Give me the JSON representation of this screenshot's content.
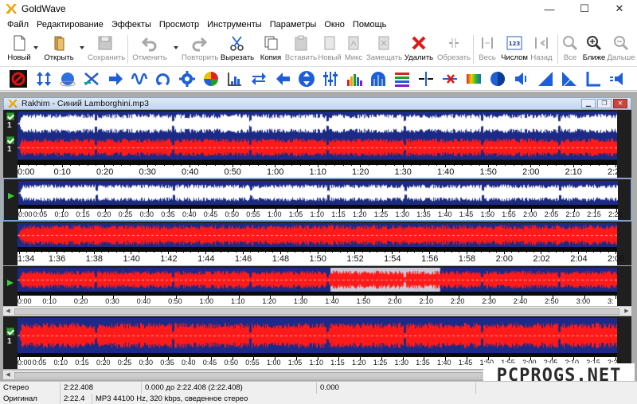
{
  "window": {
    "title": "GoldWave",
    "minimize": "—",
    "maximize": "☐",
    "close": "✕"
  },
  "menu": [
    "Файл",
    "Редактирование",
    "Эффекты",
    "Просмотр",
    "Инструменты",
    "Параметры",
    "Окно",
    "Помощь"
  ],
  "toolbar": [
    {
      "id": "new",
      "label": "Новый",
      "enabled": true
    },
    {
      "id": "open",
      "label": "Открыть",
      "enabled": true
    },
    {
      "id": "save",
      "label": "Сохранить",
      "enabled": false
    },
    {
      "id": "undo",
      "label": "Отменить",
      "enabled": false
    },
    {
      "id": "redo",
      "label": "Повторить",
      "enabled": false
    },
    {
      "id": "cut",
      "label": "Вырезать",
      "enabled": true
    },
    {
      "id": "copy",
      "label": "Копия",
      "enabled": true
    },
    {
      "id": "paste",
      "label": "Вставить",
      "enabled": false
    },
    {
      "id": "paste-new",
      "label": "Новый",
      "enabled": false
    },
    {
      "id": "mix",
      "label": "Микс",
      "enabled": false
    },
    {
      "id": "replace",
      "label": "Замещать",
      "enabled": false
    },
    {
      "id": "delete",
      "label": "Удалить",
      "enabled": true
    },
    {
      "id": "trim",
      "label": "Обрезать",
      "enabled": false
    },
    {
      "id": "all",
      "label": "Весь",
      "enabled": false
    },
    {
      "id": "numeric",
      "label": "Числом",
      "enabled": true
    },
    {
      "id": "back",
      "label": "Назад",
      "enabled": false
    },
    {
      "id": "zoom-all",
      "label": "Все",
      "enabled": false
    },
    {
      "id": "zoom-in",
      "label": "Ближе",
      "enabled": true
    },
    {
      "id": "zoom-out",
      "label": "Дальше",
      "enabled": false
    }
  ],
  "document": {
    "title": "Rakhim - Синий Lamborghini.mp3"
  },
  "channels": {
    "ch1": "1",
    "ch2": "1"
  },
  "rulers": {
    "main": [
      "0:00",
      "0:10",
      "0:20",
      "0:30",
      "0:40",
      "0:50",
      "1:00",
      "1:10",
      "1:20",
      "1:30",
      "1:40",
      "1:50",
      "2:00",
      "2:10",
      "2:2"
    ],
    "overview1": [
      "0:00",
      "0:05",
      "0:10",
      "0:15",
      "0:20",
      "0:25",
      "0:30",
      "0:35",
      "0:40",
      "0:45",
      "0:50",
      "0:55",
      "1:00",
      "1:05",
      "1:10",
      "1:15",
      "1:20",
      "1:25",
      "1:30",
      "1:35",
      "1:40",
      "1:45",
      "1:50",
      "1:55",
      "2:00",
      "2:05",
      "2:10",
      "2:15",
      "2:20"
    ],
    "zoomed": [
      "1:34",
      "1:36",
      "1:38",
      "1:40",
      "1:42",
      "1:44",
      "1:46",
      "1:48",
      "1:50",
      "1:52",
      "1:54",
      "1:56",
      "1:58",
      "2:00",
      "2:02",
      "2:04",
      "2:06"
    ],
    "overview2": [
      "0:00",
      "0:10",
      "0:20",
      "0:30",
      "0:40",
      "0:50",
      "1:00",
      "1:10",
      "1:20",
      "1:30",
      "1:40",
      "1:50",
      "2:00",
      "2:10",
      "2:20",
      "2:30",
      "2:40",
      "2:50",
      "3:00",
      "3:"
    ],
    "overview3": [
      "0:00",
      "0:05",
      "0:10",
      "0:15",
      "0:20",
      "0:25",
      "0:30",
      "0:35",
      "0:40",
      "0:45",
      "0:50",
      "0:55",
      "1:00",
      "1:05",
      "1:10",
      "1:15",
      "1:20",
      "1:25",
      "1:30",
      "1:35",
      "1:40",
      "1:45",
      "1:50",
      "1:55",
      "2:00",
      "2:05",
      "2:10",
      "2:15",
      "2:20"
    ]
  },
  "selection": {
    "start": 0.522,
    "end": 0.705
  },
  "status": {
    "row1": {
      "mode": "Стерео",
      "length": "2:22.408",
      "range": "0.000 до 2:22.408 (2:22.408)",
      "position": "0.000"
    },
    "row2": {
      "label": "Оригинал",
      "length": "2:22.4",
      "format": "MP3 44100 Hz, 320 kbps, сведенное стерео"
    }
  },
  "watermark": "PCPROGS.NET",
  "colors": {
    "wave_blue": "#1b2a87",
    "wave_red": "#ff1a1a",
    "wave_white": "#ffffff",
    "selection": "#d8d8d8"
  }
}
